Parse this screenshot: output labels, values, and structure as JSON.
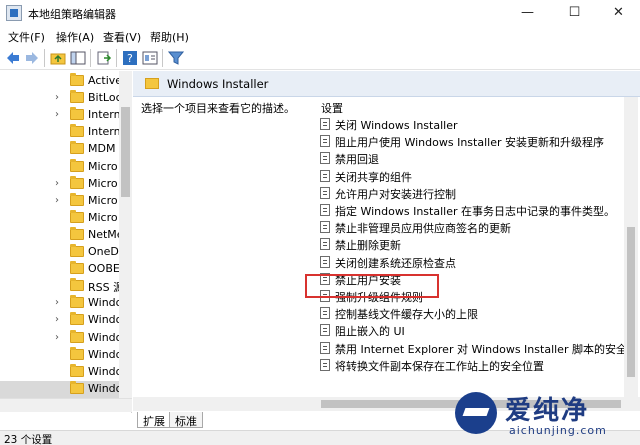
{
  "window": {
    "title": "本地组策略编辑器",
    "minimize": "—",
    "maximize": "☐",
    "close": "✕"
  },
  "menu": [
    "文件(F)",
    "操作(A)",
    "查看(V)",
    "帮助(H)"
  ],
  "tree": {
    "items": [
      {
        "label": "Active",
        "expand": ""
      },
      {
        "label": "BitLoc",
        "expand": "›"
      },
      {
        "label": "Intern",
        "expand": "›"
      },
      {
        "label": "Intern",
        "expand": ""
      },
      {
        "label": "MDM",
        "expand": ""
      },
      {
        "label": "Micro",
        "expand": ""
      },
      {
        "label": "Micro",
        "expand": "›"
      },
      {
        "label": "Micro",
        "expand": "›"
      },
      {
        "label": "Micro",
        "expand": ""
      },
      {
        "label": "NetMe",
        "expand": ""
      },
      {
        "label": "OneDr",
        "expand": ""
      },
      {
        "label": "OOBE",
        "expand": ""
      },
      {
        "label": "RSS 源",
        "expand": ""
      },
      {
        "label": "Windo",
        "expand": "›"
      },
      {
        "label": "Windo",
        "expand": "›"
      },
      {
        "label": "Windo",
        "expand": "›"
      },
      {
        "label": "Windo",
        "expand": ""
      },
      {
        "label": "Windo",
        "expand": ""
      },
      {
        "label": "Windo",
        "expand": ""
      }
    ],
    "selected_index": 18
  },
  "right": {
    "folder_title": "Windows Installer",
    "description": "选择一个项目来查看它的描述。",
    "column_header": "设置",
    "policies": [
      "关闭 Windows Installer",
      "阻止用户使用 Windows Installer 安装更新和升级程序",
      "禁用回退",
      "关闭共享的组件",
      "允许用户对安装进行控制",
      "指定 Windows Installer 在事务日志中记录的事件类型。",
      "禁止非管理员应用供应商签名的更新",
      "禁止删除更新",
      "关闭创建系统还原检查点",
      "禁止用户安装",
      "强制升级组件规则",
      "控制基线文件缓存大小的上限",
      "阻止嵌入的 UI",
      "禁用 Internet Explorer 对 Windows Installer 脚本的安全...",
      "将转换文件副本保存在工作站上的安全位置"
    ],
    "highlighted_policy_index": 9
  },
  "tabs": [
    "扩展",
    "标准"
  ],
  "active_tab_index": 0,
  "status": "23 个设置",
  "watermark": {
    "brand": "爱纯净",
    "url": "aichunjing.com"
  },
  "colors": {
    "highlight_border": "#d8322f",
    "header_bg": "#e8eef6",
    "brand": "#1f3c82"
  }
}
